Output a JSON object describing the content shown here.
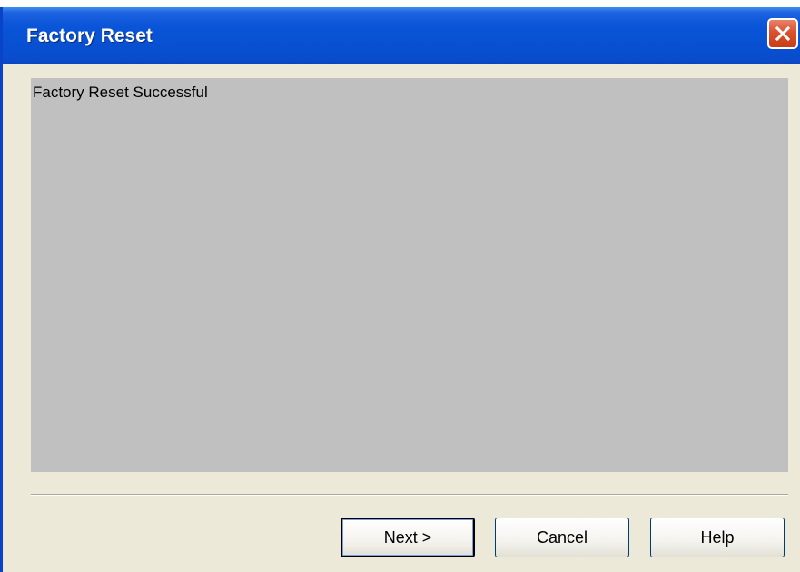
{
  "window": {
    "title": "Factory Reset",
    "close_icon": "close-icon"
  },
  "content": {
    "message": "Factory Reset Successful"
  },
  "buttons": {
    "next_label": "Next >",
    "cancel_label": "Cancel",
    "help_label": "Help"
  },
  "colors": {
    "titlebar": "#0a55d8",
    "close_button": "#d9512e",
    "dialog_background": "#ece9d8",
    "content_panel": "#c0c0c0"
  }
}
